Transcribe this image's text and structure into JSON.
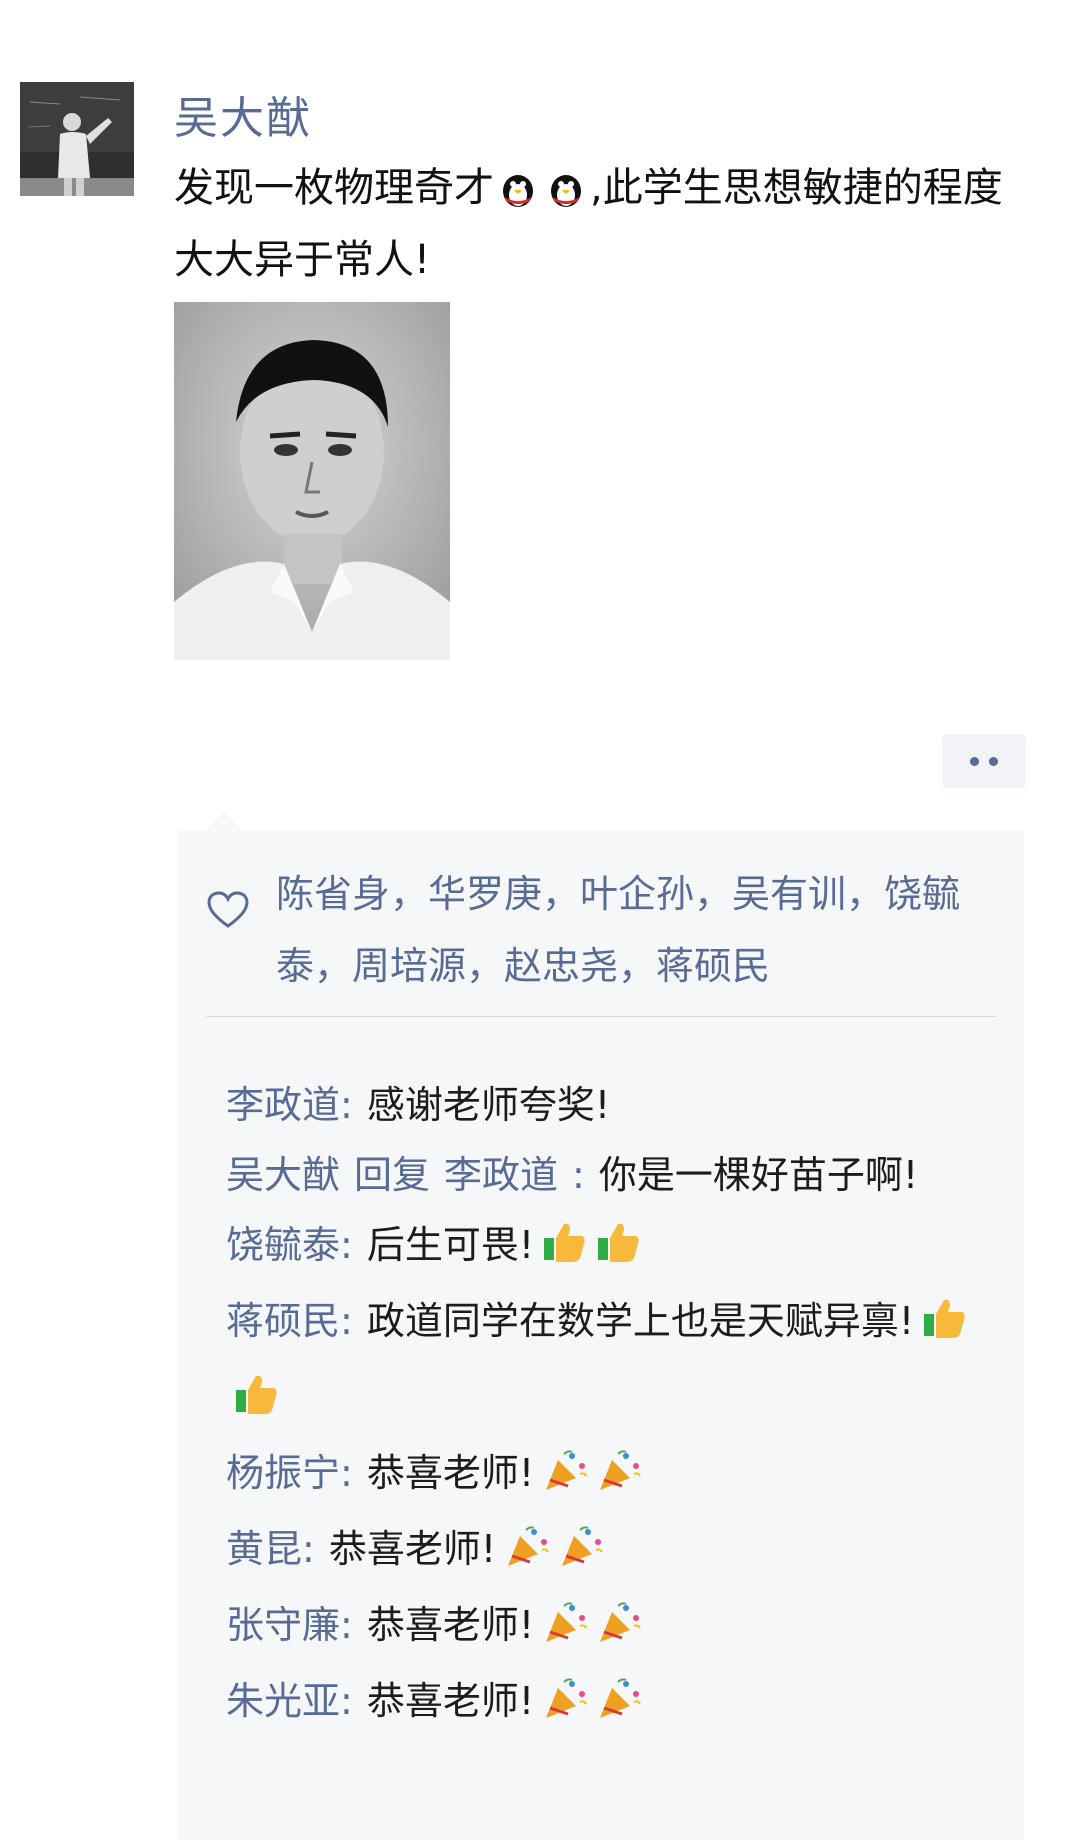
{
  "post": {
    "author": "吴大猷",
    "text_part1": "发现一枚物理奇才",
    "text_part2": ",此学生思想敏捷的程度大大异于常人!"
  },
  "likes": {
    "names": "陈省身，华罗庚，叶企孙，吴有训，饶毓泰，周培源，赵忠尧，蒋硕民"
  },
  "comments": [
    {
      "name": "李政道:",
      "text": "感谢老师夸奖!",
      "emojis": []
    },
    {
      "name": "吴大猷",
      "reply_word": "回复",
      "reply_to": "李政道",
      "colon": ":",
      "text": "你是一棵好苗子啊!",
      "emojis": []
    },
    {
      "name": "饶毓泰:",
      "text": "后生可畏!",
      "emojis": [
        "thumbs-up-icon",
        "thumbs-up-icon"
      ]
    },
    {
      "name": "蒋硕民:",
      "text": "政道同学在数学上也是天赋异禀!",
      "emojis": [
        "thumbs-up-icon",
        "thumbs-up-icon"
      ]
    },
    {
      "name": "杨振宁:",
      "text": "恭喜老师!",
      "emojis": [
        "party-popper-icon",
        "party-popper-icon"
      ]
    },
    {
      "name": "黄昆:",
      "text": "恭喜老师!",
      "emojis": [
        "party-popper-icon",
        "party-popper-icon"
      ]
    },
    {
      "name": "张守廉:",
      "text": "恭喜老师!",
      "emojis": [
        "party-popper-icon",
        "party-popper-icon"
      ]
    },
    {
      "name": "朱光亚:",
      "text": "恭喜老师!",
      "emojis": [
        "party-popper-icon",
        "party-popper-icon"
      ]
    }
  ],
  "colors": {
    "link": "#576b95",
    "panel": "#f6f7f9"
  }
}
